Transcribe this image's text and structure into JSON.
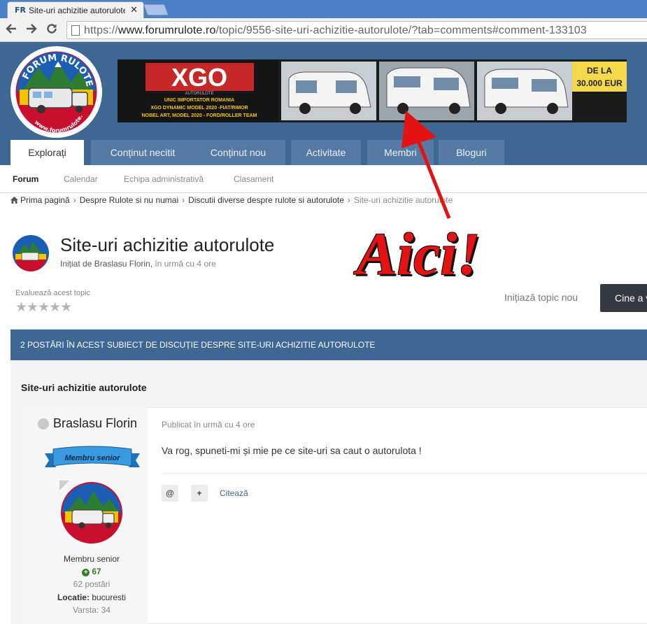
{
  "browser": {
    "tab_title": "Site-uri achizitie autorulote - D",
    "favicon_text": "FR",
    "close_glyph": "✕",
    "url_prefix": "https://",
    "url_host": "www.forumrulote.ro",
    "url_path": "/topic/9556-site-uri-achizitie-autorulote/?tab=comments#comment-133103"
  },
  "logo": {
    "text": "FORUM RULOTE",
    "site": "www.forumrulote.ro"
  },
  "banner": {
    "brand": "XGO",
    "brand_sub": "AUTORULOTE",
    "line1": "UNIC IMPORTATOR ROMANIA",
    "line2": "XGO DYNAMIC MODEL 2020 -FIAT/RIMOR",
    "line3": "NOBEL ART, MODEL 2020 - FORD/ROLLER TEAM",
    "price_line1": "DE LA",
    "price_line2": "30.000 EUR"
  },
  "nav": {
    "tabs": [
      {
        "label": "Explorați"
      },
      {
        "label": "Conținut necitit"
      },
      {
        "label": "Conținut nou"
      },
      {
        "label": "Activitate"
      },
      {
        "label": "Membri"
      },
      {
        "label": "Bloguri"
      }
    ],
    "sub": [
      {
        "label": "Forum"
      },
      {
        "label": "Calendar"
      },
      {
        "label": "Echipa administrativă"
      },
      {
        "label": "Clasament"
      }
    ]
  },
  "breadcrumb": [
    {
      "label": "Prima pagină"
    },
    {
      "label": "Despre Rulote si nu numai"
    },
    {
      "label": "Discutii diverse despre rulote si autorulote"
    },
    {
      "label": "Site-uri achizitie autorulote"
    }
  ],
  "topic": {
    "title": "Site-uri achizitie autorulote",
    "started_by": "Inițiat de Braslasu Florin,",
    "time": "în urmă cu 4 ore",
    "rate_label": "Evaluează acest topic",
    "stars": "★★★★★",
    "start_new": "Inițiază topic nou",
    "reply_button": "Cine a văzut"
  },
  "posts_bar": "2 POSTĂRI ÎN ACEST SUBIECT DE DISCUȚIE DESPRE SITE-URI ACHIZITIE AUTORULOTE",
  "section_title": "Site-uri achizitie autorulote",
  "post": {
    "author": "Braslasu Florin",
    "rank_ribbon": "Membru senior",
    "rank": "Membru senior",
    "reputation": "67",
    "post_count": "62 postări",
    "location_label": "Locatie:",
    "location_value": "bucuresti",
    "age": "Varsta: 34",
    "date": "Publicat în urmă cu 4 ore",
    "body": "Va rog, spuneti-mi și mie pe ce site-uri sa caut o autorulota !",
    "mention_glyph": "@",
    "plus_glyph": "+",
    "quote_label": "Citează"
  },
  "annotation": {
    "text": "Aici!"
  },
  "colors": {
    "header_blue": "#3e6794",
    "tab_blue": "#557ba4",
    "annotation_red": "#e31313",
    "reputation_green": "#3b7a2a"
  },
  "icons": {
    "back": "arrow-left",
    "forward": "arrow-right",
    "reload": "reload",
    "home": "home",
    "star": "star",
    "reputation": "plus-circle"
  }
}
